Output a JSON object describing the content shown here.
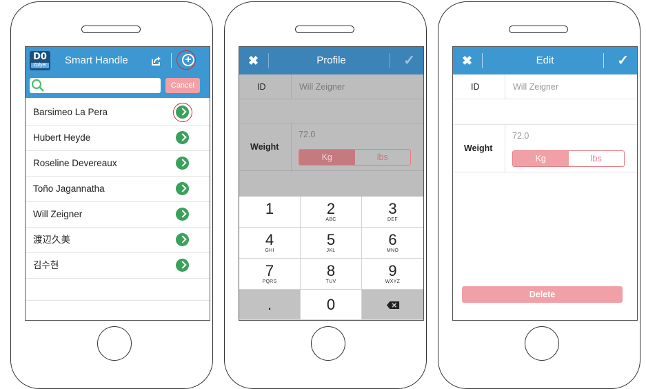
{
  "colors": {
    "nav_bar": "#3d97d1",
    "go_icon": "#3aa15b",
    "highlight_circle": "#e02626",
    "button_pink": "#f2a0a7",
    "segment_active": "#e57d84"
  },
  "contacts_screen": {
    "logo": {
      "main": "D0",
      "sub": "Zplyer"
    },
    "title": "Smart Handle",
    "search": {
      "placeholder": "",
      "cancel_label": "Cancel"
    },
    "contacts": [
      {
        "name": "Barsimeo La Pera"
      },
      {
        "name": "Hubert Heyde"
      },
      {
        "name": "Roseline Devereaux"
      },
      {
        "name": "Toño Jagannatha"
      },
      {
        "name": "Will Zeigner"
      },
      {
        "name": "渡辺久美"
      },
      {
        "name": "김수현"
      }
    ],
    "icons": {
      "share": "share-icon",
      "add": "plus-circle-icon",
      "row_action": "chevron-right-circle-icon"
    }
  },
  "profile_screen": {
    "title": "Profile",
    "close_glyph": "✖",
    "confirm_glyph": "✓",
    "id_label": "ID",
    "id_value": "Will Zeigner",
    "weight_label": "Weight",
    "weight_value": "72.0",
    "unit_options": [
      "Kg",
      "lbs"
    ],
    "selected_unit": "Kg",
    "keypad": [
      {
        "digit": "1",
        "letters": ""
      },
      {
        "digit": "2",
        "letters": "ABC"
      },
      {
        "digit": "3",
        "letters": "DEF"
      },
      {
        "digit": "4",
        "letters": "GHI"
      },
      {
        "digit": "5",
        "letters": "JKL"
      },
      {
        "digit": "6",
        "letters": "MNO"
      },
      {
        "digit": "7",
        "letters": "PQRS"
      },
      {
        "digit": "8",
        "letters": "TUV"
      },
      {
        "digit": "9",
        "letters": "WXYZ"
      },
      {
        "digit": ".",
        "letters": ""
      },
      {
        "digit": "0",
        "letters": ""
      },
      {
        "digit": "⌫",
        "letters": ""
      }
    ]
  },
  "edit_screen": {
    "title": "Edit",
    "close_glyph": "✖",
    "confirm_glyph": "✓",
    "id_label": "ID",
    "id_value": "Will Zeigner",
    "weight_label": "Weight",
    "weight_value": "72.0",
    "unit_options": [
      "Kg",
      "lbs"
    ],
    "selected_unit": "Kg",
    "delete_label": "Delete"
  }
}
